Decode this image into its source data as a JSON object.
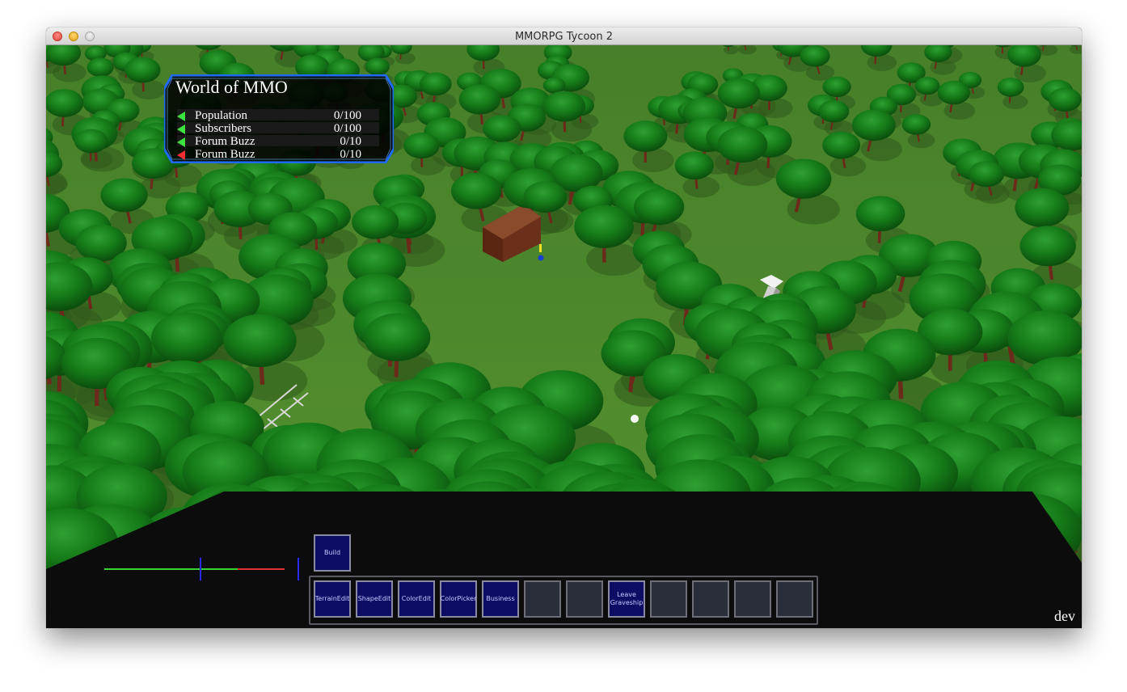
{
  "window": {
    "title": "MMORPG Tycoon 2"
  },
  "hud": {
    "title": "World of MMO",
    "stats": [
      {
        "label": "Population",
        "value": "0/100",
        "trend": "up",
        "color": "#3ee23e"
      },
      {
        "label": "Subscribers",
        "value": "0/100",
        "trend": "up",
        "color": "#3ee23e"
      },
      {
        "label": "Forum Buzz",
        "value": "0/10",
        "trend": "up",
        "color": "#3ee23e"
      },
      {
        "label": "Forum Buzz",
        "value": "0/10",
        "trend": "down",
        "color": "#f03030"
      }
    ]
  },
  "toolbar": {
    "build_label": "Build",
    "slots": [
      "TerrainEdit",
      "ShapeEdit",
      "ColorEdit",
      "ColorPicker",
      "Business",
      "",
      "",
      "Leave Graveship",
      "",
      "",
      "",
      ""
    ]
  },
  "balance_bar": {
    "positive_color": "#35d235",
    "negative_color": "#e03030",
    "marker_color": "#2a2aff",
    "positive_fraction": 0.74
  },
  "corner_label": "dev",
  "colors": {
    "hud_border": "#1f6bff",
    "slot_filled": "#0d0d66",
    "slot_empty": "#2a2d3a"
  }
}
